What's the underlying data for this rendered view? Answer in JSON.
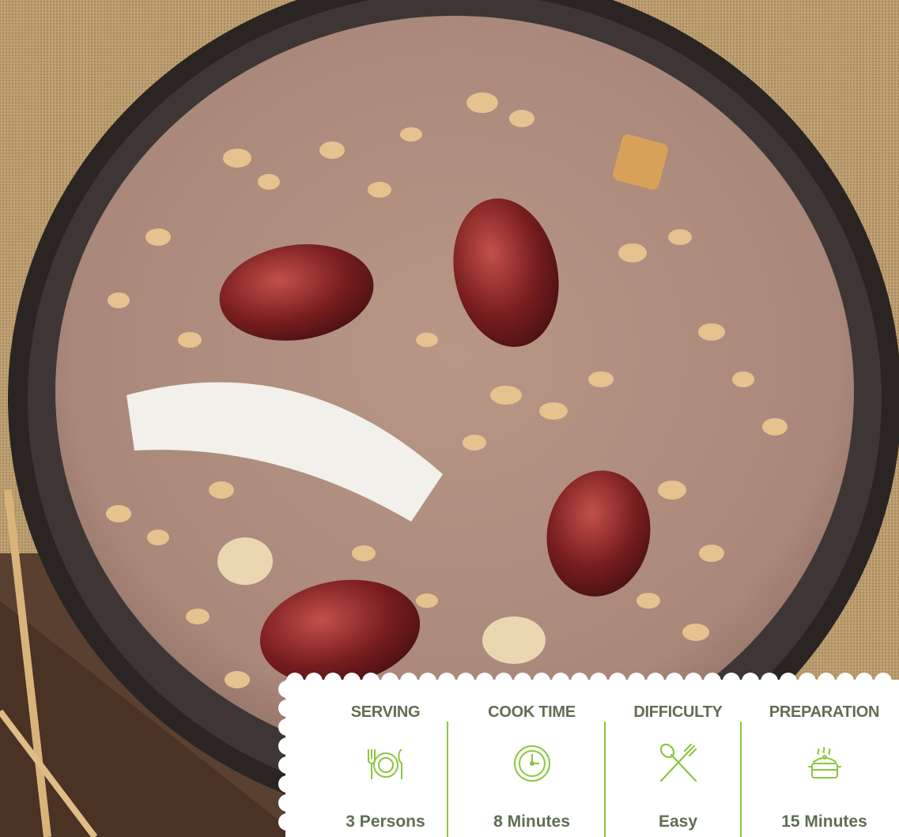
{
  "image": {
    "subject": "smoothie-bowl"
  },
  "stats": [
    {
      "title": "SERVING",
      "value": "3 Persons",
      "icon": "plate-cutlery-icon"
    },
    {
      "title": "COOK TIME",
      "value": "8 Minutes",
      "icon": "clock-icon"
    },
    {
      "title": "DIFFICULTY",
      "value": "Easy",
      "icon": "crossed-spoon-fork-icon"
    },
    {
      "title": "PREPARATION",
      "value": "15 Minutes",
      "icon": "steaming-pot-icon"
    }
  ],
  "colors": {
    "text": "#5f6f52",
    "accent_green": "#8cc63f",
    "card_bg": "#ffffff"
  }
}
